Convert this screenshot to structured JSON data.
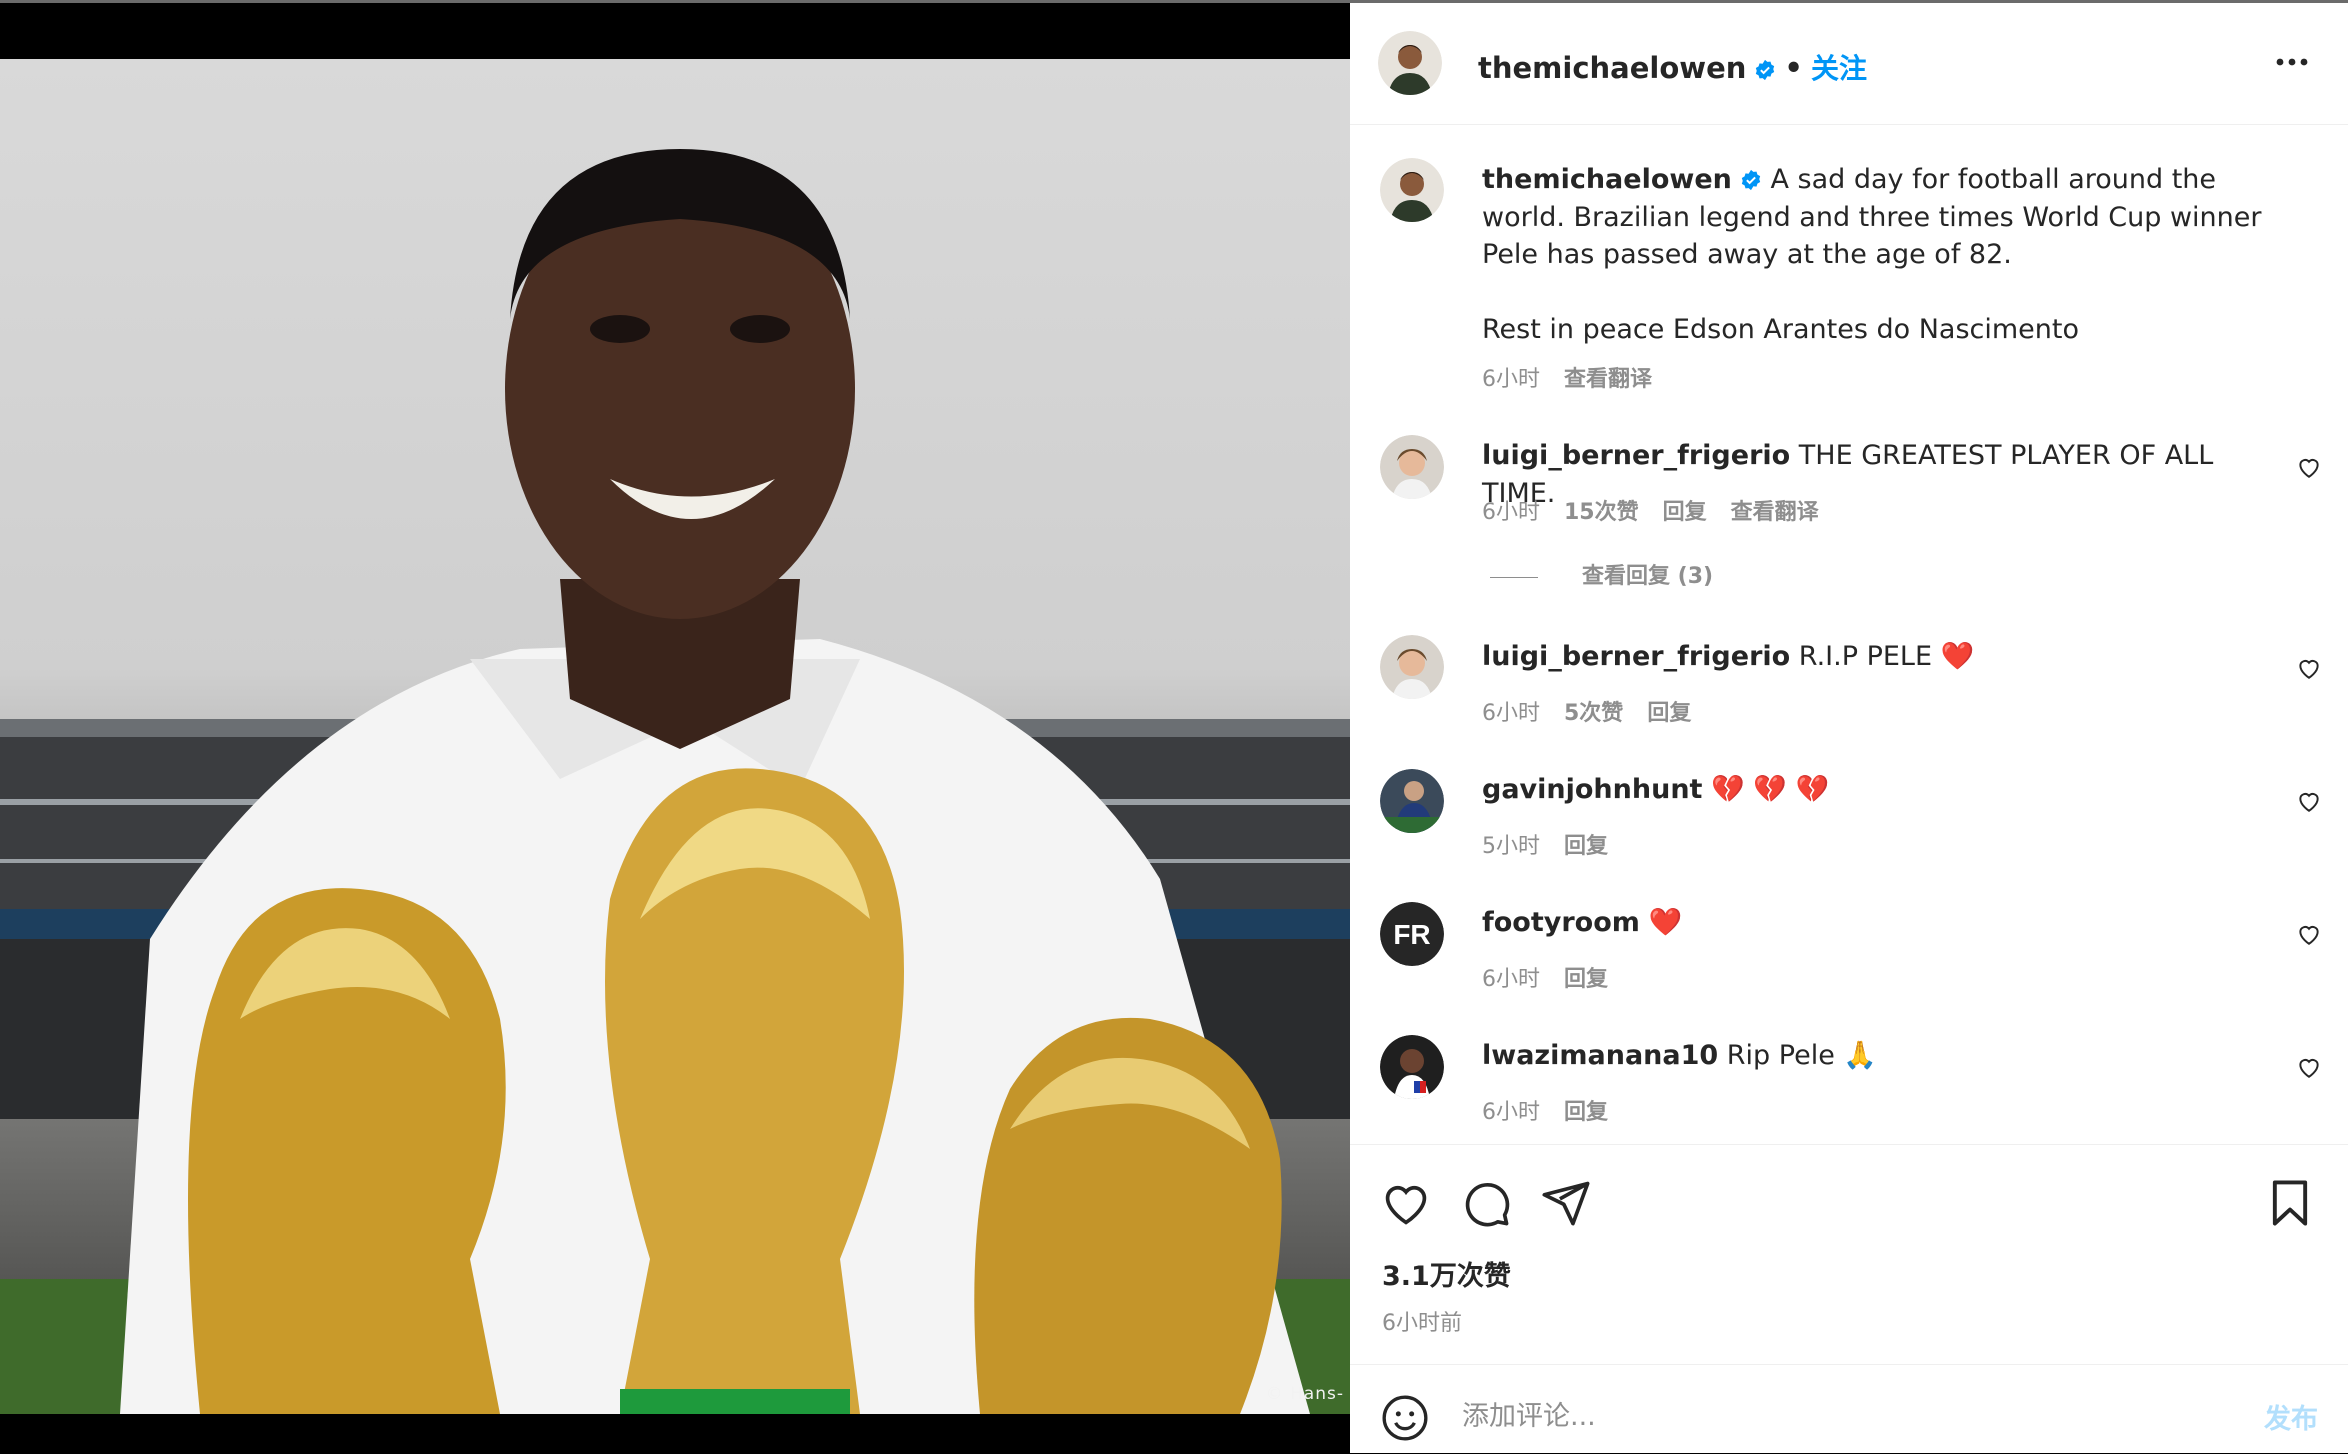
{
  "photo": {
    "alt": "",
    "credit": "© Hans-"
  },
  "header": {
    "username": "themichaelowen",
    "separator": "•",
    "follow_label": "关注",
    "more_icon": "more-horizontal-icon"
  },
  "caption": {
    "username": "themichaelowen",
    "text": "A sad day for football around the world. Brazilian legend and three times World Cup winner Pele has passed away at the age of 82.",
    "text2": "Rest in peace Edson Arantes do Nascimento",
    "time": "6小时",
    "translate": "查看翻译"
  },
  "comments": [
    {
      "username": "luigi_berner_frigerio",
      "text": "THE GREATEST PLAYER OF ALL TIME.",
      "time": "6小时",
      "likes": "15次赞",
      "reply": "回复",
      "translate": "查看翻译"
    },
    {
      "username": "luigi_berner_frigerio",
      "text": "R.I.P PELE ❤️",
      "time": "6小时",
      "likes": "5次赞",
      "reply": "回复"
    },
    {
      "username": "gavinjohnhunt",
      "text": "💔 💔 💔",
      "time": "5小时",
      "reply": "回复"
    },
    {
      "username": "footyroom",
      "text": "❤️",
      "time": "6小时",
      "reply": "回复"
    },
    {
      "username": "lwazimanana10",
      "text": "Rip Pele 🙏",
      "time": "6小时",
      "reply": "回复"
    }
  ],
  "view_replies": "查看回复 (3)",
  "footer": {
    "likes": "3.1万次赞",
    "time_ago": "6小时前",
    "comment_placeholder": "添加评论...",
    "post_label": "发布"
  },
  "colors": {
    "accent": "#0095f6",
    "verified": "#0095f6",
    "heart": "#ed4956",
    "muted": "#8e8e8e"
  }
}
